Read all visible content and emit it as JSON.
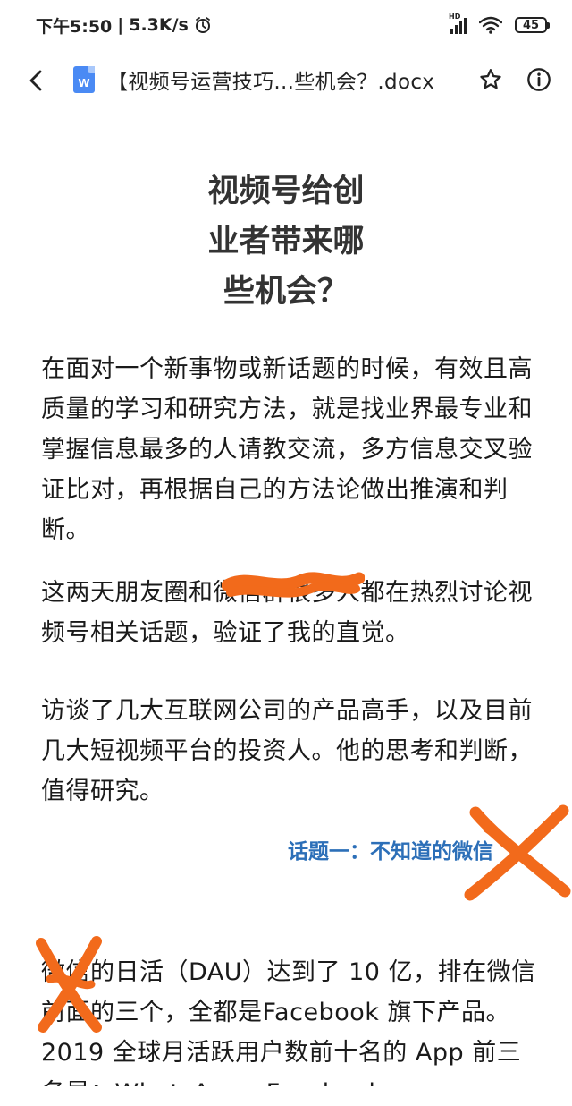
{
  "status_bar": {
    "time": "下午5:50",
    "separator": "|",
    "net_speed": "5.3K/s",
    "battery": "45",
    "hd_label": "HD",
    "icons": [
      "alarm-icon",
      "signal-icon",
      "wifi-icon",
      "battery-icon"
    ]
  },
  "app_bar": {
    "title": "【视频号运营技巧...些机会？.docx",
    "doc_type_badge": "W",
    "icons": [
      "back-arrow-icon",
      "word-doc-icon",
      "star-outline-icon",
      "info-icon"
    ]
  },
  "document": {
    "heading_lines": [
      "视频号给创",
      "业者带来哪",
      "些机会？"
    ],
    "paragraphs": [
      "在面对一个新事物或新话题的时候，有效且高质量的学习和研究方法，就是找业界最专业和掌握信息最多的人请教交流，多方信息交叉验证比对，再根据自己的方法论做出推演和判断。",
      "这两天朋友圈和微信群很多人都在热烈讨论视频号相关话题，验证了我的直觉。",
      "访谈了几大互联网公司的产品高手，以及目前几大短视频平台的投资人。他的思考和判断，值得研究。"
    ],
    "topic_heading": "话题一：不知道的微信",
    "paragraph_4": "微信的日活（DAU）达到了 10 亿，排在微信前面的三个，全都是Facebook 旗下产品。2019 全球月活跃用户数前十名的 App 前三名是：WhatsApp、Facebook、"
  },
  "colors": {
    "accent_blue": "#2c6fb8",
    "doc_icon_blue": "#4a8af4",
    "scribble_orange": "#f26a1b"
  }
}
